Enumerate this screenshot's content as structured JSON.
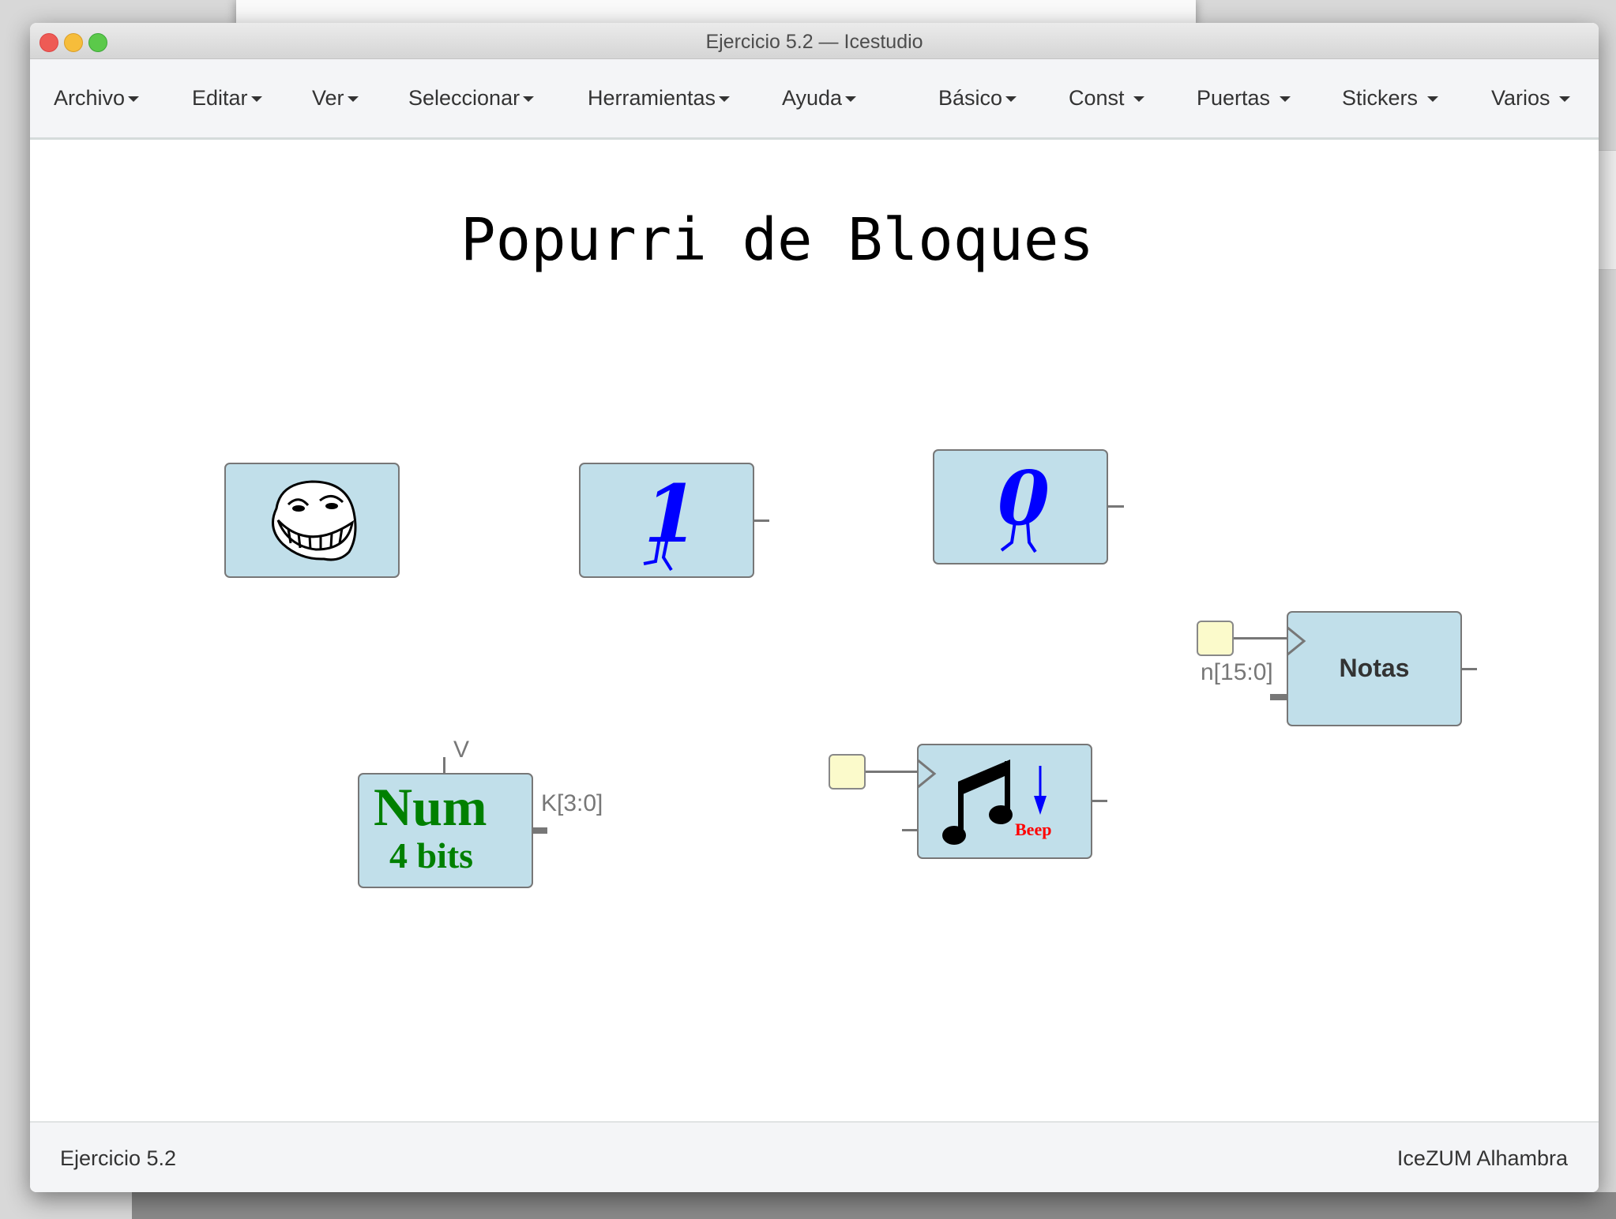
{
  "window": {
    "title": "Ejercicio 5.2 — Icestudio"
  },
  "menubar": {
    "items": [
      {
        "label": "Archivo"
      },
      {
        "label": "Editar"
      },
      {
        "label": "Ver"
      },
      {
        "label": "Seleccionar"
      },
      {
        "label": "Herramientas"
      },
      {
        "label": "Ayuda"
      },
      {
        "label": "Básico"
      },
      {
        "label": "Const"
      },
      {
        "label": "Puertas"
      },
      {
        "label": "Stickers"
      },
      {
        "label": "Varios"
      }
    ]
  },
  "canvas": {
    "heading": "Popurri de Bloques",
    "blocks": {
      "troll": {
        "icon": "troll-face-icon"
      },
      "one": {
        "glyph": "1"
      },
      "zero": {
        "glyph": "0"
      },
      "notas": {
        "label": "Notas",
        "input_label": "n[15:0]"
      },
      "num": {
        "line1": "Num",
        "line2": "4 bits",
        "top_label": "V",
        "output_label": "K[3:0]"
      },
      "beep": {
        "label": "Beep",
        "icon": "music-note-icon"
      }
    },
    "colors": {
      "block": "#c1dfea",
      "input": "#fbfacb",
      "digit": "#0000ff",
      "num_text": "#008000",
      "beep_text": "#ff0000"
    }
  },
  "footer": {
    "left": "Ejercicio 5.2",
    "right": "IceZUM Alhambra"
  }
}
